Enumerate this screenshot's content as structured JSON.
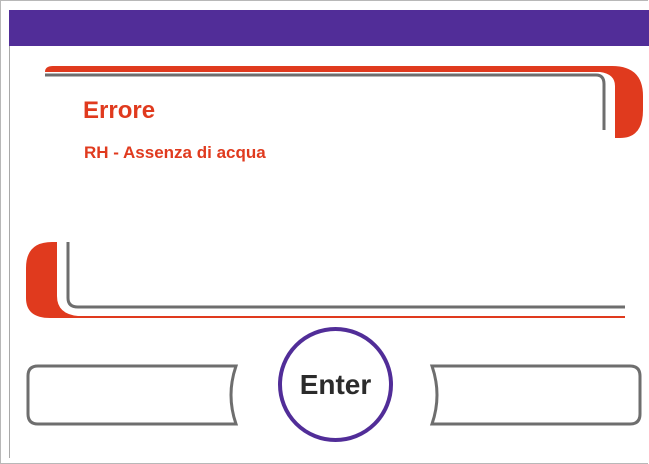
{
  "error": {
    "title": "Errore",
    "message": "RH - Assenza di acqua"
  },
  "buttons": {
    "enter_label": "Enter"
  },
  "colors": {
    "header_bar": "#512d98",
    "accent_red": "#e03a1e",
    "frame_gray": "#6e6e6e",
    "enter_ring": "#512d98"
  }
}
